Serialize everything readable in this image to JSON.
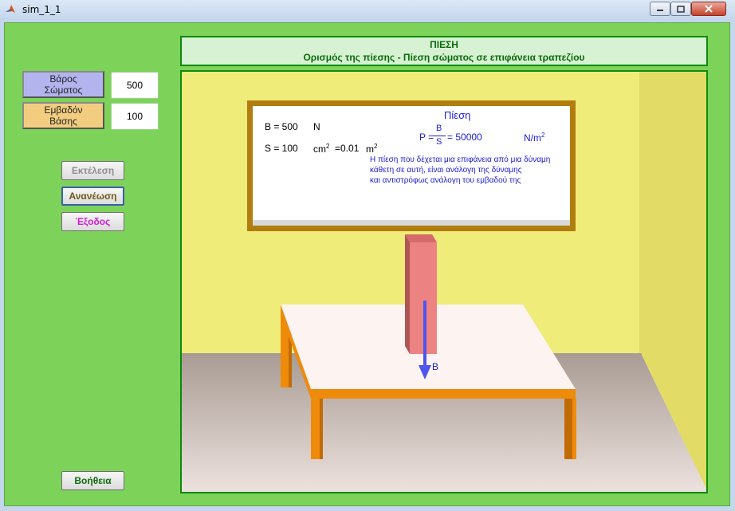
{
  "window": {
    "title": "sim_1_1"
  },
  "header": {
    "line1": "ΠΙΕΣΗ",
    "line2": "Ορισμός της πίεσης - Πίεση σώματος σε επιφάνεια τραπεζίου"
  },
  "inputs": {
    "weight_label_1": "Βάρος",
    "weight_label_2": "Σώματος",
    "weight_value": "500",
    "area_label_1": "Εμβαδόν",
    "area_label_2": "Βάσης",
    "area_value": "100"
  },
  "buttons": {
    "run": "Εκτέλεση",
    "refresh": "Ανανέωση",
    "exit": "Έξοδος",
    "help": "Βοήθεια"
  },
  "board": {
    "title": "Πίεση",
    "b_label": "B = 500",
    "b_unit": "N",
    "s_label": "S = 100",
    "s_unit_a": "cm",
    "s_eq": "=0.01",
    "s_unit_b": "m",
    "p_lhs": "P =",
    "frac_num": "B",
    "frac_den": "S",
    "p_value": "= 50000",
    "p_unit": "N/m",
    "exp": "2",
    "desc_1": "Η πίεση που δέχεται μια επιφάνεια από μια δύναμη",
    "desc_2": "κάθετη σε αυτή, είναι ανάλογη της δύναμης",
    "desc_3": "και αντιστρόφως ανάλογη του εμβαδού της"
  },
  "scene": {
    "force_label": "B"
  },
  "colors": {
    "client_bg": "#7dd35a",
    "wall": "#efec79",
    "side_wall": "#e2dc66",
    "floor": "#a99b95",
    "board_frame": "#b07d0e",
    "table_top": "#fdf3f1",
    "table_legs": "#ef8b0a",
    "block": "#ec8282",
    "arrow": "#4f55ef",
    "header_text": "#0b6b0b"
  }
}
